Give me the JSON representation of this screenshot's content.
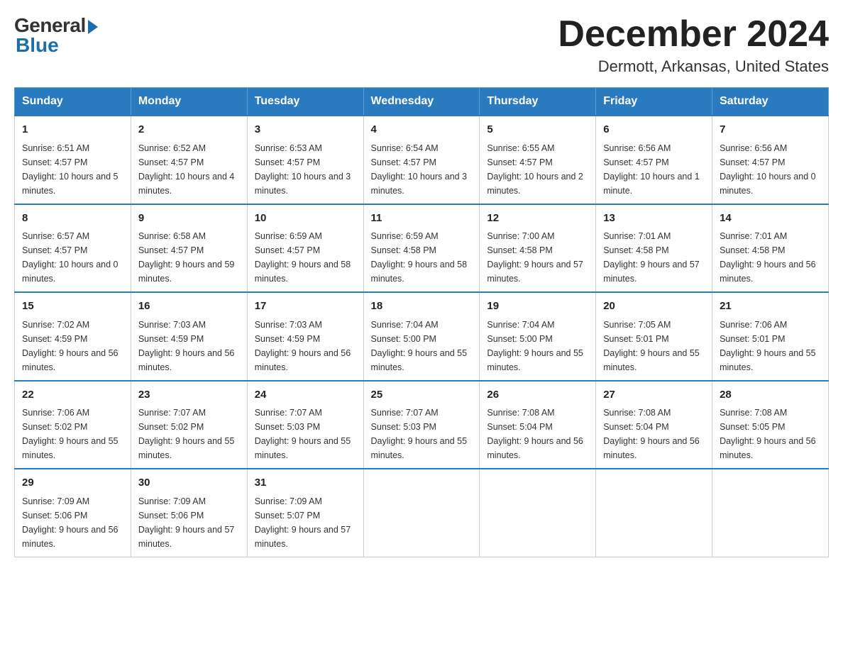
{
  "logo": {
    "general": "General",
    "blue": "Blue"
  },
  "title": "December 2024",
  "location": "Dermott, Arkansas, United States",
  "days_of_week": [
    "Sunday",
    "Monday",
    "Tuesday",
    "Wednesday",
    "Thursday",
    "Friday",
    "Saturday"
  ],
  "weeks": [
    [
      {
        "day": "1",
        "sunrise": "6:51 AM",
        "sunset": "4:57 PM",
        "daylight": "10 hours and 5 minutes."
      },
      {
        "day": "2",
        "sunrise": "6:52 AM",
        "sunset": "4:57 PM",
        "daylight": "10 hours and 4 minutes."
      },
      {
        "day": "3",
        "sunrise": "6:53 AM",
        "sunset": "4:57 PM",
        "daylight": "10 hours and 3 minutes."
      },
      {
        "day": "4",
        "sunrise": "6:54 AM",
        "sunset": "4:57 PM",
        "daylight": "10 hours and 3 minutes."
      },
      {
        "day": "5",
        "sunrise": "6:55 AM",
        "sunset": "4:57 PM",
        "daylight": "10 hours and 2 minutes."
      },
      {
        "day": "6",
        "sunrise": "6:56 AM",
        "sunset": "4:57 PM",
        "daylight": "10 hours and 1 minute."
      },
      {
        "day": "7",
        "sunrise": "6:56 AM",
        "sunset": "4:57 PM",
        "daylight": "10 hours and 0 minutes."
      }
    ],
    [
      {
        "day": "8",
        "sunrise": "6:57 AM",
        "sunset": "4:57 PM",
        "daylight": "10 hours and 0 minutes."
      },
      {
        "day": "9",
        "sunrise": "6:58 AM",
        "sunset": "4:57 PM",
        "daylight": "9 hours and 59 minutes."
      },
      {
        "day": "10",
        "sunrise": "6:59 AM",
        "sunset": "4:57 PM",
        "daylight": "9 hours and 58 minutes."
      },
      {
        "day": "11",
        "sunrise": "6:59 AM",
        "sunset": "4:58 PM",
        "daylight": "9 hours and 58 minutes."
      },
      {
        "day": "12",
        "sunrise": "7:00 AM",
        "sunset": "4:58 PM",
        "daylight": "9 hours and 57 minutes."
      },
      {
        "day": "13",
        "sunrise": "7:01 AM",
        "sunset": "4:58 PM",
        "daylight": "9 hours and 57 minutes."
      },
      {
        "day": "14",
        "sunrise": "7:01 AM",
        "sunset": "4:58 PM",
        "daylight": "9 hours and 56 minutes."
      }
    ],
    [
      {
        "day": "15",
        "sunrise": "7:02 AM",
        "sunset": "4:59 PM",
        "daylight": "9 hours and 56 minutes."
      },
      {
        "day": "16",
        "sunrise": "7:03 AM",
        "sunset": "4:59 PM",
        "daylight": "9 hours and 56 minutes."
      },
      {
        "day": "17",
        "sunrise": "7:03 AM",
        "sunset": "4:59 PM",
        "daylight": "9 hours and 56 minutes."
      },
      {
        "day": "18",
        "sunrise": "7:04 AM",
        "sunset": "5:00 PM",
        "daylight": "9 hours and 55 minutes."
      },
      {
        "day": "19",
        "sunrise": "7:04 AM",
        "sunset": "5:00 PM",
        "daylight": "9 hours and 55 minutes."
      },
      {
        "day": "20",
        "sunrise": "7:05 AM",
        "sunset": "5:01 PM",
        "daylight": "9 hours and 55 minutes."
      },
      {
        "day": "21",
        "sunrise": "7:06 AM",
        "sunset": "5:01 PM",
        "daylight": "9 hours and 55 minutes."
      }
    ],
    [
      {
        "day": "22",
        "sunrise": "7:06 AM",
        "sunset": "5:02 PM",
        "daylight": "9 hours and 55 minutes."
      },
      {
        "day": "23",
        "sunrise": "7:07 AM",
        "sunset": "5:02 PM",
        "daylight": "9 hours and 55 minutes."
      },
      {
        "day": "24",
        "sunrise": "7:07 AM",
        "sunset": "5:03 PM",
        "daylight": "9 hours and 55 minutes."
      },
      {
        "day": "25",
        "sunrise": "7:07 AM",
        "sunset": "5:03 PM",
        "daylight": "9 hours and 55 minutes."
      },
      {
        "day": "26",
        "sunrise": "7:08 AM",
        "sunset": "5:04 PM",
        "daylight": "9 hours and 56 minutes."
      },
      {
        "day": "27",
        "sunrise": "7:08 AM",
        "sunset": "5:04 PM",
        "daylight": "9 hours and 56 minutes."
      },
      {
        "day": "28",
        "sunrise": "7:08 AM",
        "sunset": "5:05 PM",
        "daylight": "9 hours and 56 minutes."
      }
    ],
    [
      {
        "day": "29",
        "sunrise": "7:09 AM",
        "sunset": "5:06 PM",
        "daylight": "9 hours and 56 minutes."
      },
      {
        "day": "30",
        "sunrise": "7:09 AM",
        "sunset": "5:06 PM",
        "daylight": "9 hours and 57 minutes."
      },
      {
        "day": "31",
        "sunrise": "7:09 AM",
        "sunset": "5:07 PM",
        "daylight": "9 hours and 57 minutes."
      },
      null,
      null,
      null,
      null
    ]
  ],
  "labels": {
    "sunrise": "Sunrise:",
    "sunset": "Sunset:",
    "daylight": "Daylight:"
  }
}
